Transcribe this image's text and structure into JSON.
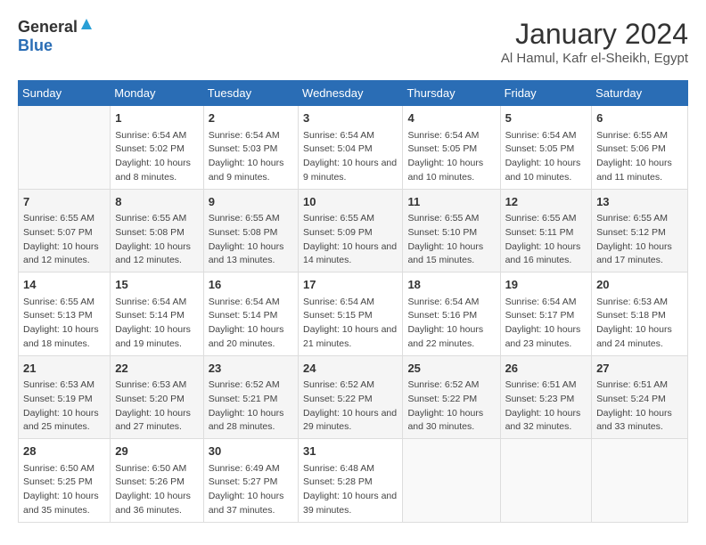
{
  "header": {
    "logo_general": "General",
    "logo_blue": "Blue",
    "month": "January 2024",
    "location": "Al Hamul, Kafr el-Sheikh, Egypt"
  },
  "columns": [
    "Sunday",
    "Monday",
    "Tuesday",
    "Wednesday",
    "Thursday",
    "Friday",
    "Saturday"
  ],
  "weeks": [
    [
      {
        "day": "",
        "sunrise": "",
        "sunset": "",
        "daylight": ""
      },
      {
        "day": "1",
        "sunrise": "Sunrise: 6:54 AM",
        "sunset": "Sunset: 5:02 PM",
        "daylight": "Daylight: 10 hours and 8 minutes."
      },
      {
        "day": "2",
        "sunrise": "Sunrise: 6:54 AM",
        "sunset": "Sunset: 5:03 PM",
        "daylight": "Daylight: 10 hours and 9 minutes."
      },
      {
        "day": "3",
        "sunrise": "Sunrise: 6:54 AM",
        "sunset": "Sunset: 5:04 PM",
        "daylight": "Daylight: 10 hours and 9 minutes."
      },
      {
        "day": "4",
        "sunrise": "Sunrise: 6:54 AM",
        "sunset": "Sunset: 5:05 PM",
        "daylight": "Daylight: 10 hours and 10 minutes."
      },
      {
        "day": "5",
        "sunrise": "Sunrise: 6:54 AM",
        "sunset": "Sunset: 5:05 PM",
        "daylight": "Daylight: 10 hours and 10 minutes."
      },
      {
        "day": "6",
        "sunrise": "Sunrise: 6:55 AM",
        "sunset": "Sunset: 5:06 PM",
        "daylight": "Daylight: 10 hours and 11 minutes."
      }
    ],
    [
      {
        "day": "7",
        "sunrise": "Sunrise: 6:55 AM",
        "sunset": "Sunset: 5:07 PM",
        "daylight": "Daylight: 10 hours and 12 minutes."
      },
      {
        "day": "8",
        "sunrise": "Sunrise: 6:55 AM",
        "sunset": "Sunset: 5:08 PM",
        "daylight": "Daylight: 10 hours and 12 minutes."
      },
      {
        "day": "9",
        "sunrise": "Sunrise: 6:55 AM",
        "sunset": "Sunset: 5:08 PM",
        "daylight": "Daylight: 10 hours and 13 minutes."
      },
      {
        "day": "10",
        "sunrise": "Sunrise: 6:55 AM",
        "sunset": "Sunset: 5:09 PM",
        "daylight": "Daylight: 10 hours and 14 minutes."
      },
      {
        "day": "11",
        "sunrise": "Sunrise: 6:55 AM",
        "sunset": "Sunset: 5:10 PM",
        "daylight": "Daylight: 10 hours and 15 minutes."
      },
      {
        "day": "12",
        "sunrise": "Sunrise: 6:55 AM",
        "sunset": "Sunset: 5:11 PM",
        "daylight": "Daylight: 10 hours and 16 minutes."
      },
      {
        "day": "13",
        "sunrise": "Sunrise: 6:55 AM",
        "sunset": "Sunset: 5:12 PM",
        "daylight": "Daylight: 10 hours and 17 minutes."
      }
    ],
    [
      {
        "day": "14",
        "sunrise": "Sunrise: 6:55 AM",
        "sunset": "Sunset: 5:13 PM",
        "daylight": "Daylight: 10 hours and 18 minutes."
      },
      {
        "day": "15",
        "sunrise": "Sunrise: 6:54 AM",
        "sunset": "Sunset: 5:14 PM",
        "daylight": "Daylight: 10 hours and 19 minutes."
      },
      {
        "day": "16",
        "sunrise": "Sunrise: 6:54 AM",
        "sunset": "Sunset: 5:14 PM",
        "daylight": "Daylight: 10 hours and 20 minutes."
      },
      {
        "day": "17",
        "sunrise": "Sunrise: 6:54 AM",
        "sunset": "Sunset: 5:15 PM",
        "daylight": "Daylight: 10 hours and 21 minutes."
      },
      {
        "day": "18",
        "sunrise": "Sunrise: 6:54 AM",
        "sunset": "Sunset: 5:16 PM",
        "daylight": "Daylight: 10 hours and 22 minutes."
      },
      {
        "day": "19",
        "sunrise": "Sunrise: 6:54 AM",
        "sunset": "Sunset: 5:17 PM",
        "daylight": "Daylight: 10 hours and 23 minutes."
      },
      {
        "day": "20",
        "sunrise": "Sunrise: 6:53 AM",
        "sunset": "Sunset: 5:18 PM",
        "daylight": "Daylight: 10 hours and 24 minutes."
      }
    ],
    [
      {
        "day": "21",
        "sunrise": "Sunrise: 6:53 AM",
        "sunset": "Sunset: 5:19 PM",
        "daylight": "Daylight: 10 hours and 25 minutes."
      },
      {
        "day": "22",
        "sunrise": "Sunrise: 6:53 AM",
        "sunset": "Sunset: 5:20 PM",
        "daylight": "Daylight: 10 hours and 27 minutes."
      },
      {
        "day": "23",
        "sunrise": "Sunrise: 6:52 AM",
        "sunset": "Sunset: 5:21 PM",
        "daylight": "Daylight: 10 hours and 28 minutes."
      },
      {
        "day": "24",
        "sunrise": "Sunrise: 6:52 AM",
        "sunset": "Sunset: 5:22 PM",
        "daylight": "Daylight: 10 hours and 29 minutes."
      },
      {
        "day": "25",
        "sunrise": "Sunrise: 6:52 AM",
        "sunset": "Sunset: 5:22 PM",
        "daylight": "Daylight: 10 hours and 30 minutes."
      },
      {
        "day": "26",
        "sunrise": "Sunrise: 6:51 AM",
        "sunset": "Sunset: 5:23 PM",
        "daylight": "Daylight: 10 hours and 32 minutes."
      },
      {
        "day": "27",
        "sunrise": "Sunrise: 6:51 AM",
        "sunset": "Sunset: 5:24 PM",
        "daylight": "Daylight: 10 hours and 33 minutes."
      }
    ],
    [
      {
        "day": "28",
        "sunrise": "Sunrise: 6:50 AM",
        "sunset": "Sunset: 5:25 PM",
        "daylight": "Daylight: 10 hours and 35 minutes."
      },
      {
        "day": "29",
        "sunrise": "Sunrise: 6:50 AM",
        "sunset": "Sunset: 5:26 PM",
        "daylight": "Daylight: 10 hours and 36 minutes."
      },
      {
        "day": "30",
        "sunrise": "Sunrise: 6:49 AM",
        "sunset": "Sunset: 5:27 PM",
        "daylight": "Daylight: 10 hours and 37 minutes."
      },
      {
        "day": "31",
        "sunrise": "Sunrise: 6:48 AM",
        "sunset": "Sunset: 5:28 PM",
        "daylight": "Daylight: 10 hours and 39 minutes."
      },
      {
        "day": "",
        "sunrise": "",
        "sunset": "",
        "daylight": ""
      },
      {
        "day": "",
        "sunrise": "",
        "sunset": "",
        "daylight": ""
      },
      {
        "day": "",
        "sunrise": "",
        "sunset": "",
        "daylight": ""
      }
    ]
  ]
}
